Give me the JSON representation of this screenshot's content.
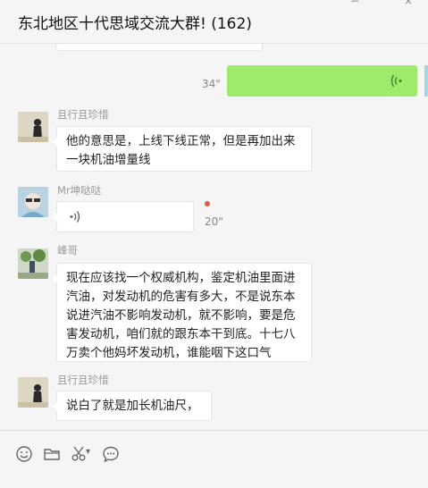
{
  "chat": {
    "title": "东北地区十代思域交流大群! (162)",
    "window_controls": {
      "minimize": "−",
      "close": "×"
    }
  },
  "messages": [
    {
      "type": "voice",
      "direction": "sent",
      "duration": "34\""
    },
    {
      "type": "text",
      "sender": "且行且珍惜",
      "lines": [
        "他的意思是，上线下线正常，但是再加出来",
        "一块机油增量线"
      ]
    },
    {
      "type": "voice",
      "sender": "Mr坤哒哒",
      "duration": "20\"",
      "unread": true
    },
    {
      "type": "text",
      "sender": "峰哥",
      "lines": [
        "现在应该找一个权威机构，鉴定机油里面进",
        "汽油，对发动机的危害有多大，不是说东本",
        "说进汽油不影响发动机，就不影响，要是危",
        "害发动机，咱们就的跟东本干到底。十七八",
        "万卖个他妈坏发动机，谁能咽下这口气"
      ]
    },
    {
      "type": "text",
      "sender": "且行且珍惜",
      "lines": [
        "说白了就是加长机油尺，"
      ]
    }
  ],
  "toolbar": {
    "icons": [
      "emoji-icon",
      "folder-icon",
      "scissors-icon",
      "chat-bubble-icon"
    ],
    "scissors_dropdown": "▾"
  },
  "colors": {
    "sent_bubble": "#9eea6a",
    "unread_dot": "#e05a3f",
    "background": "#f5f5f5"
  }
}
